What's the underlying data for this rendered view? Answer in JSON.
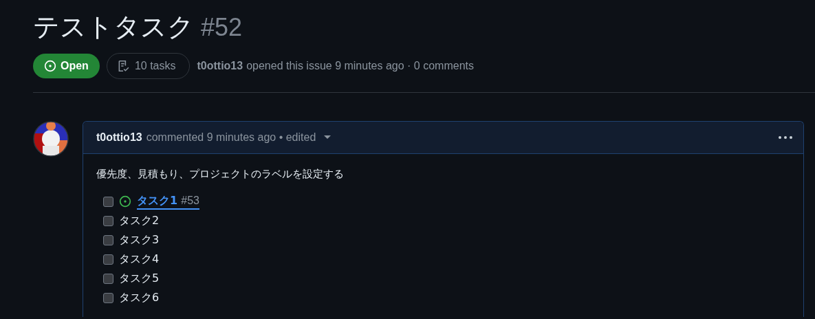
{
  "issue": {
    "title": "テストタスク",
    "number": "#52",
    "state": {
      "label": "Open",
      "kind": "open"
    },
    "tasks_badge": "10 tasks",
    "author": "t0ottio13",
    "meta": "opened this issue 9 minutes ago · 0 comments"
  },
  "comment": {
    "author": "t0ottio13",
    "meta": "commented 9 minutes ago • edited",
    "body": "優先度、見積もり、プロジェクトのラベルを設定する",
    "tasks": [
      {
        "kind": "issue",
        "label": "タスク1",
        "number": "#53",
        "checked": false
      },
      {
        "kind": "plain",
        "label": "タスク2",
        "checked": false
      },
      {
        "kind": "plain",
        "label": "タスク3",
        "checked": false
      },
      {
        "kind": "plain",
        "label": "タスク4",
        "checked": false
      },
      {
        "kind": "plain",
        "label": "タスク5",
        "checked": false
      },
      {
        "kind": "plain",
        "label": "タスク6",
        "checked": false
      }
    ]
  }
}
